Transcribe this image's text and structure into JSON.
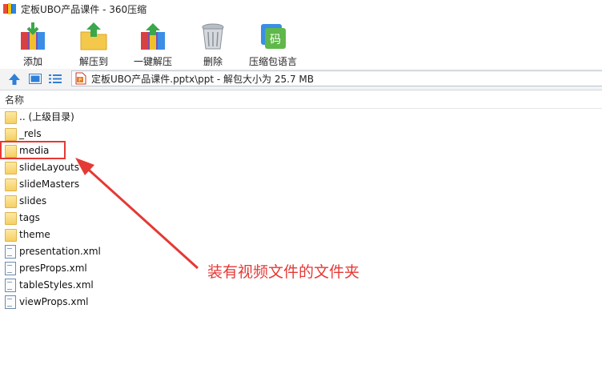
{
  "window": {
    "title": "定板UBO产品课件 - 360压缩",
    "icon": "archive-app-icon"
  },
  "toolbar": {
    "buttons": [
      {
        "label": "添加",
        "icon": "add-archive-icon"
      },
      {
        "label": "解压到",
        "icon": "extract-to-icon"
      },
      {
        "label": "一键解压",
        "icon": "one-click-extract-icon"
      },
      {
        "label": "删除",
        "icon": "trash-icon"
      },
      {
        "label": "压缩包语言",
        "icon": "archive-language-icon"
      }
    ]
  },
  "address_bar": {
    "path": "定板UBO产品课件.pptx\\ppt - 解包大小为 25.7 MB",
    "icons": [
      "up-arrow-icon",
      "thumbnail-view-icon",
      "list-view-icon",
      "pptx-file-icon"
    ]
  },
  "file_list": {
    "column_header": "名称",
    "items": [
      {
        "name": ".. (上级目录)",
        "type": "folder"
      },
      {
        "name": "_rels",
        "type": "folder"
      },
      {
        "name": "media",
        "type": "folder"
      },
      {
        "name": "slideLayouts",
        "type": "folder"
      },
      {
        "name": "slideMasters",
        "type": "folder"
      },
      {
        "name": "slides",
        "type": "folder"
      },
      {
        "name": "tags",
        "type": "folder"
      },
      {
        "name": "theme",
        "type": "folder"
      },
      {
        "name": "presentation.xml",
        "type": "xml"
      },
      {
        "name": "presProps.xml",
        "type": "xml"
      },
      {
        "name": "tableStyles.xml",
        "type": "xml"
      },
      {
        "name": "viewProps.xml",
        "type": "xml"
      }
    ]
  },
  "annotation": {
    "text": "装有视频文件的文件夹",
    "color": "#e53935"
  }
}
